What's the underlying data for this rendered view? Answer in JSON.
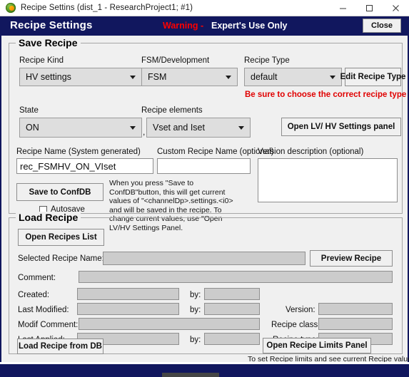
{
  "window": {
    "title": "Recipe Settins (dist_1 - ResearchProject1; #1)",
    "icon": "app-icon",
    "minimize": "minimize-icon",
    "maximize": "maximize-icon",
    "close": "close-icon"
  },
  "header": {
    "title": "Recipe Settings",
    "warning_label": "Warning -",
    "warning_text": "Expert's Use Only",
    "close_label": "Close",
    "bg_color": "#11175e",
    "warning_color": "#ff0000"
  },
  "save_recipe": {
    "group_title": "Save Recipe",
    "recipe_kind": {
      "label": "Recipe Kind",
      "value": "HV settings"
    },
    "fsm_development": {
      "label": "FSM/Development",
      "value": "FSM"
    },
    "recipe_type": {
      "label": "Recipe Type",
      "value": "default",
      "edit_button": "Edit Recipe Type",
      "note": "Be sure to choose the correct recipe type",
      "note_color": "#e00000"
    },
    "state": {
      "label": "State",
      "value": "ON",
      "separator": ","
    },
    "recipe_elements": {
      "label": "Recipe elements",
      "value": "Vset and Iset"
    },
    "open_lv_hv_button": "Open LV/ HV Settings panel",
    "recipe_name": {
      "label": "Recipe Name (System generated)",
      "value": "rec_FSMHV_ON_VIset"
    },
    "custom_recipe_name": {
      "label": "Custom Recipe Name (optional)",
      "value": ""
    },
    "version_description": {
      "label": "Version description (optional)",
      "value": ""
    },
    "save_button": "Save to ConfDB",
    "autosave": {
      "label": "Autosave",
      "checked": false
    },
    "help_text": "When you press \"Save to ConfDB\"button, this will get current values of \"<channelDp>.settings.<i0> and will be saved in the recipe. To change current values, use \"Open LV/HV Settings Panel."
  },
  "load_recipe": {
    "group_title": "Load Recipe",
    "open_recipes_list_button": "Open Recipes List",
    "selected_recipe_name": {
      "label": "Selected Recipe Name:",
      "value": ""
    },
    "preview_button": "Preview Recipe",
    "comment": {
      "label": "Comment:",
      "value": ""
    },
    "created": {
      "label": "Created:",
      "value": "",
      "by_label": "by:",
      "by_value": ""
    },
    "last_modified": {
      "label": "Last Modified:",
      "value": "",
      "by_label": "by:",
      "by_value": ""
    },
    "modif_comment": {
      "label": "Modif Comment:",
      "value": ""
    },
    "last_applied": {
      "label": "Last Applied:",
      "value": "",
      "by_label": "by:",
      "by_value": ""
    },
    "version": {
      "label": "Version:",
      "value": ""
    },
    "recipe_class": {
      "label": "Recipe class:",
      "value": ""
    },
    "recipe_type": {
      "label": "Recipe type:",
      "value": ""
    },
    "load_button": "Load Recipe from DB",
    "limits_button": "Open Recipe Limits Panel",
    "limits_note": "To set Recipe limits and see current Recipe values"
  }
}
